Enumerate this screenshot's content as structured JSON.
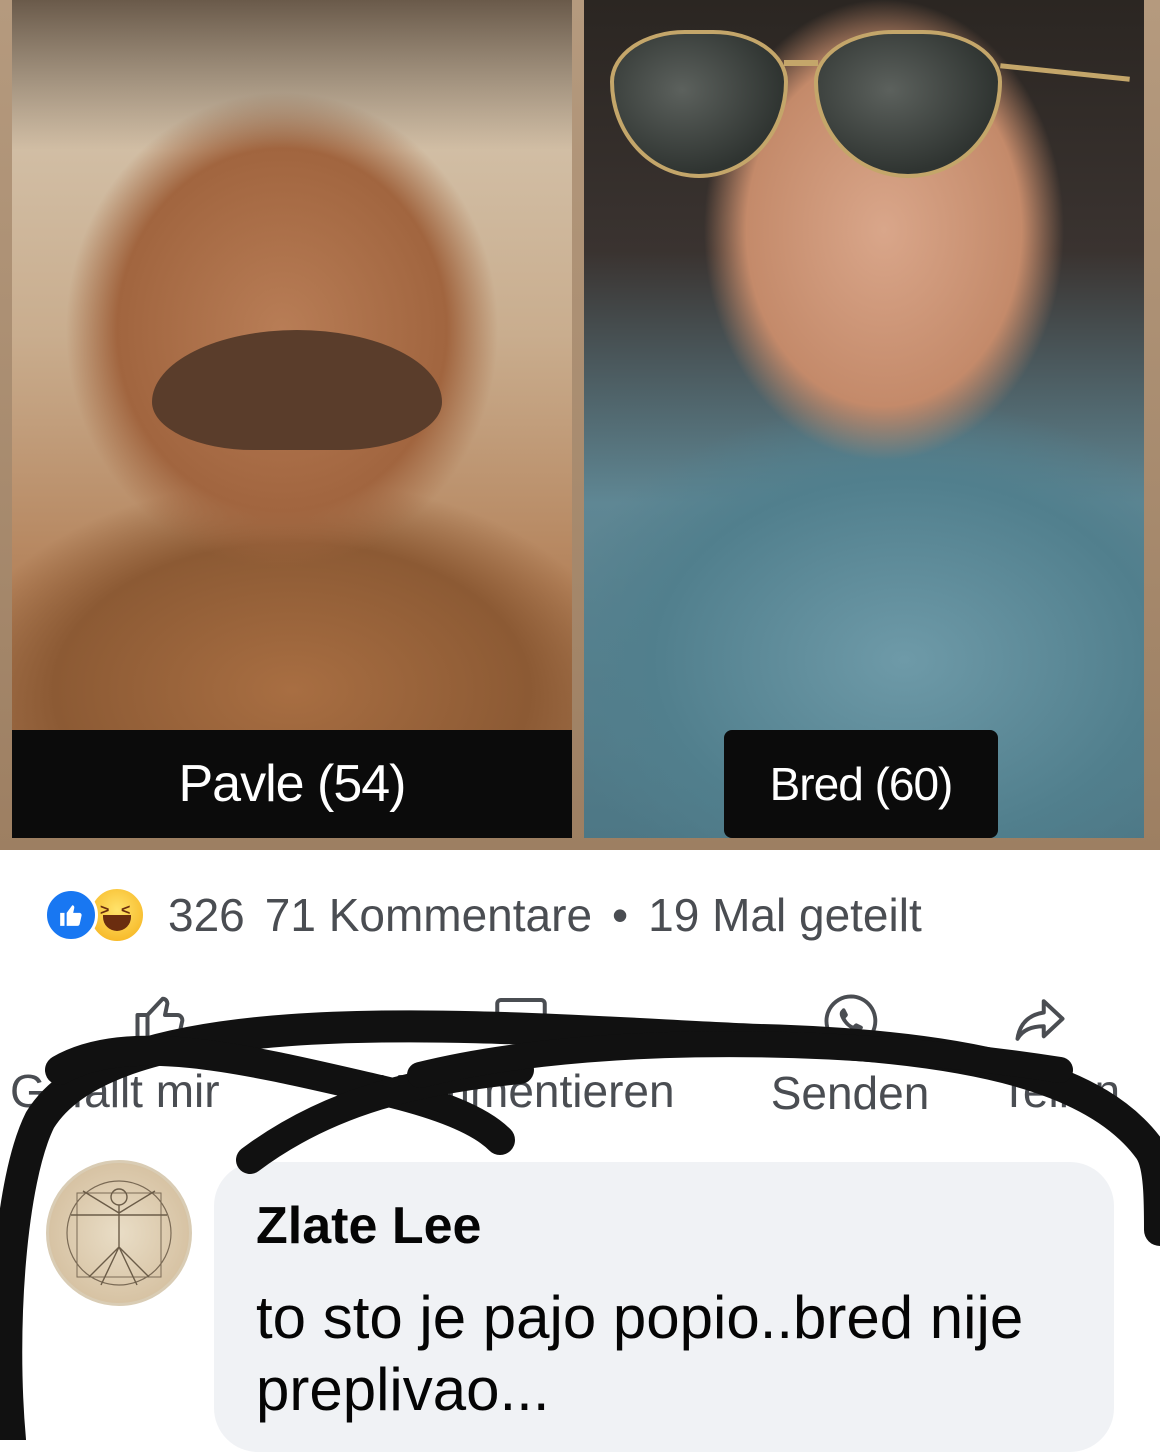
{
  "post": {
    "photos": [
      {
        "caption": "Pavle (54)"
      },
      {
        "caption": "Bred (60)"
      }
    ],
    "reactions": {
      "icons": [
        "like-icon",
        "haha-icon"
      ],
      "count": "326",
      "comments": "71 Kommentare",
      "separator": "•",
      "shares": "19 Mal geteilt"
    },
    "actions": {
      "like_label": "Gefällt mir",
      "comment_label": "Kommentieren",
      "send_label": "Senden",
      "share_label": "Teilen"
    }
  },
  "comment": {
    "author": "Zlate Lee",
    "text": "to sto je pajo popio..bred nije preplivao..."
  },
  "colors": {
    "like_blue": "#1877f2",
    "haha_yellow": "#f7b928",
    "bubble_bg": "#f0f2f5",
    "marker": "#111111",
    "meta_text": "#4a4d52"
  }
}
